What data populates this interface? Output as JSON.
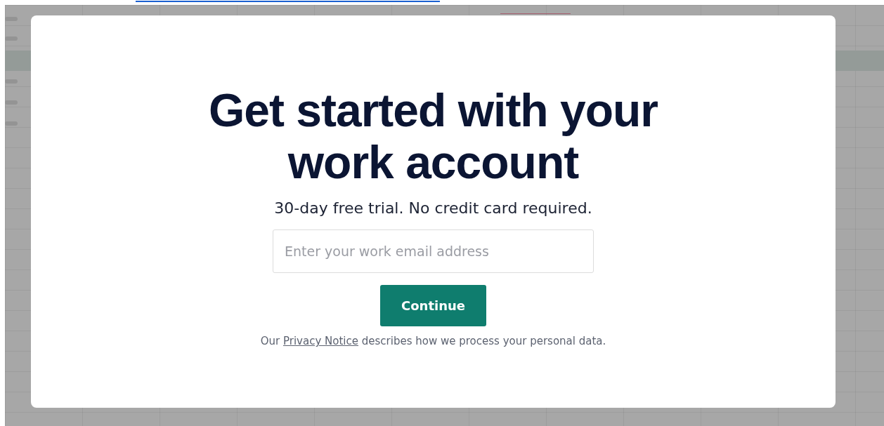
{
  "modal": {
    "title": "Get started with your work account",
    "subtitle": "30-day free trial. No credit card required.",
    "email_field": {
      "placeholder": "Enter your work email address"
    },
    "button": "Continue",
    "notice": {
      "before": "Our",
      "link": "Privacy Notice",
      "after": "describes how we process your personal data."
    }
  }
}
